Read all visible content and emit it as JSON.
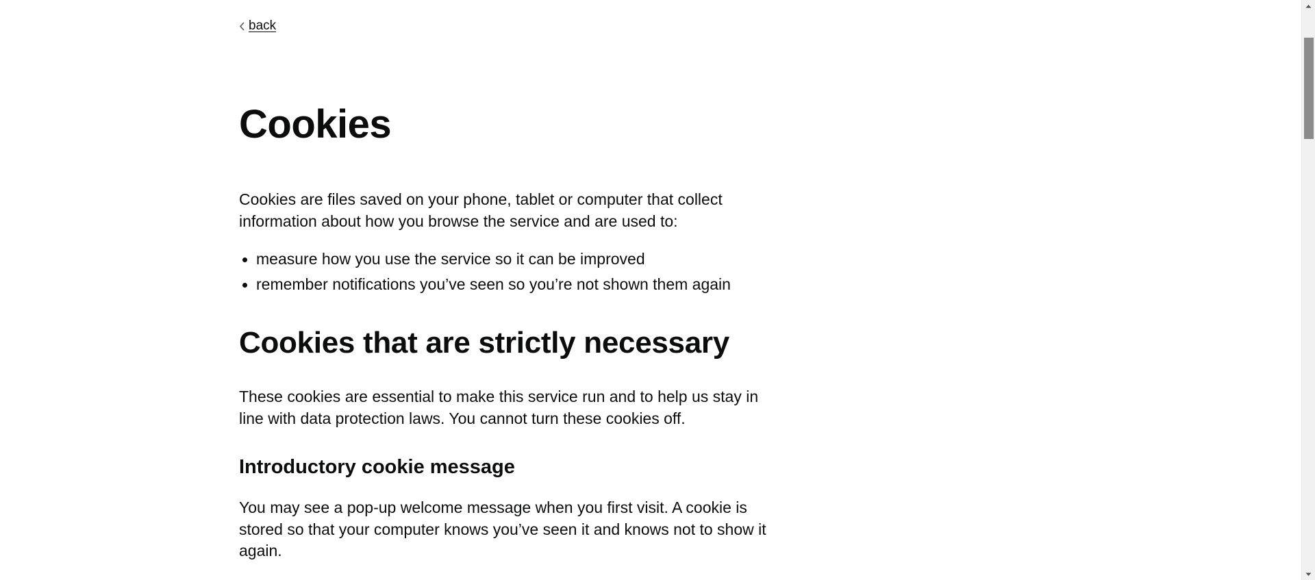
{
  "nav": {
    "back_label": "back"
  },
  "content": {
    "title": "Cookies",
    "intro": "Cookies are files saved on your phone, tablet or computer that collect information about how you browse the service and are used to:",
    "bullets": [
      "measure how you use the service so it can be improved",
      "remember notifications you’ve seen so you’re not shown them again"
    ],
    "section_heading": "Cookies that are strictly necessary",
    "section_text": "These cookies are essential to make this service run and to help us stay in line with data protection laws. You cannot turn these cookies off.",
    "subsection_heading": "Introductory cookie message",
    "subsection_text": "You may see a pop-up welcome message when you first visit. A cookie is stored so that your computer knows you’ve seen it and knows not to show it again."
  },
  "icons": {
    "back": "chevron-left-icon",
    "scroll_up": "arrow-up-icon",
    "scroll_down": "arrow-down-icon"
  },
  "colors": {
    "text": "#0b0c0c",
    "background": "#ffffff",
    "scrollbar_track": "#f1f1f1",
    "scrollbar_thumb": "#8b8b8b"
  }
}
